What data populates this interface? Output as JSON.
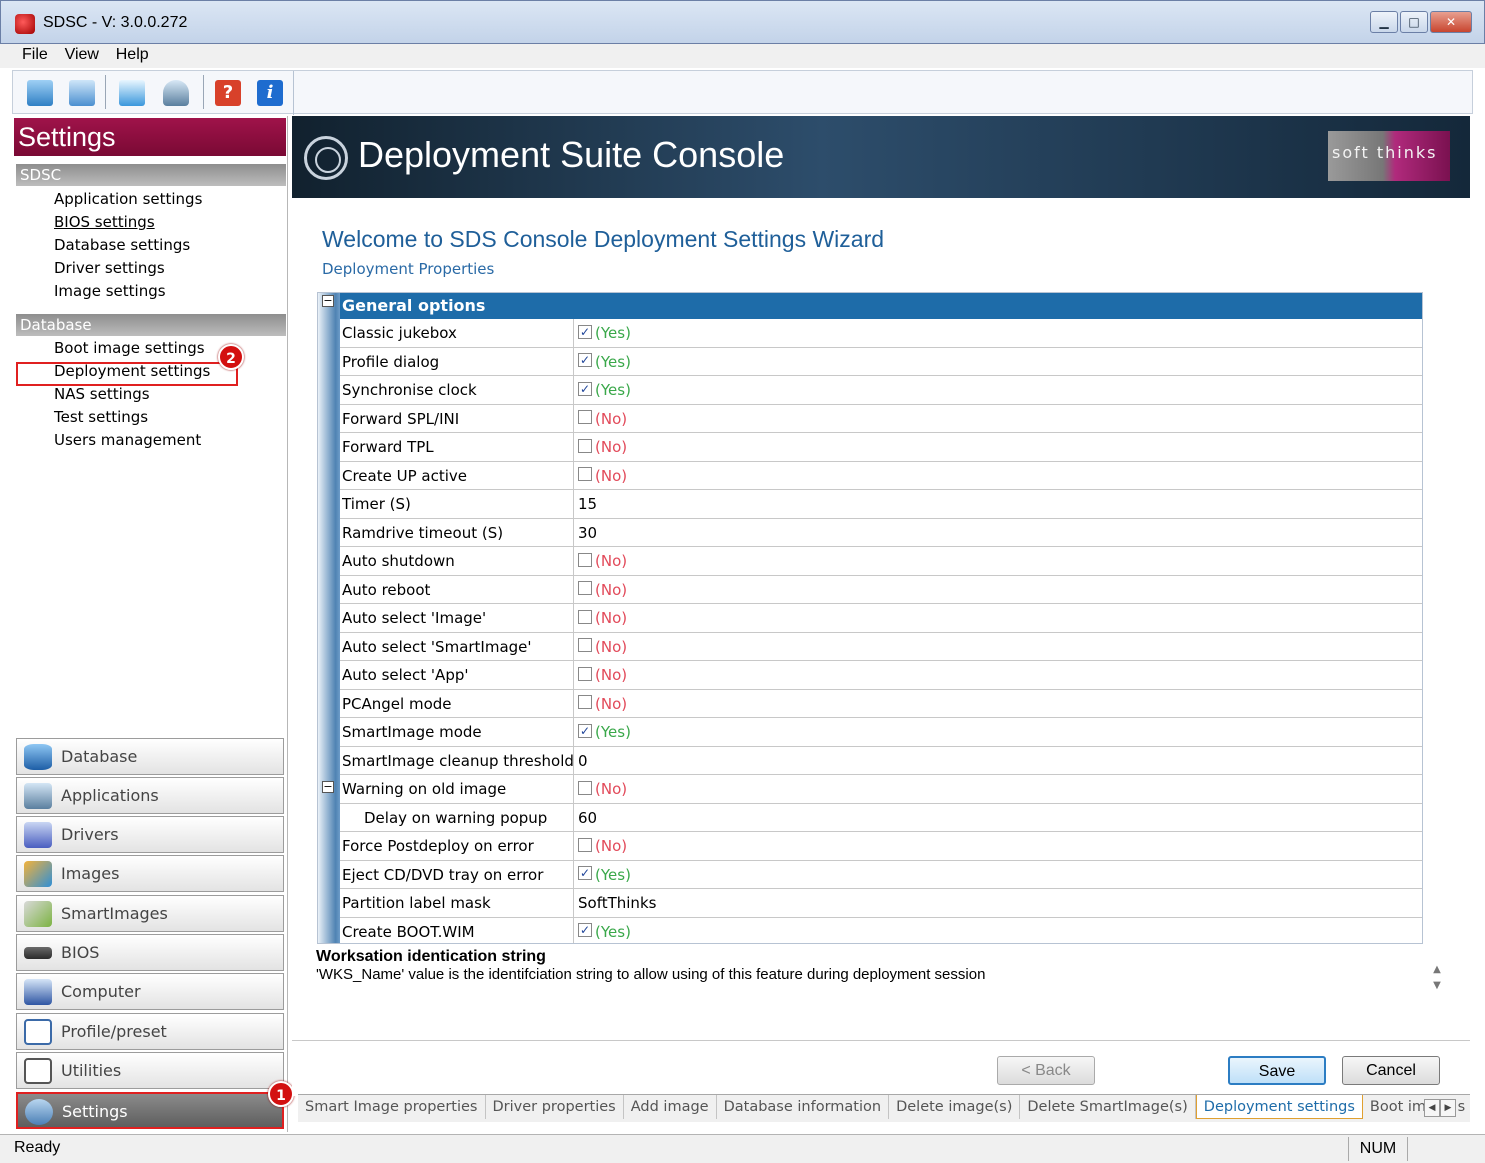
{
  "window": {
    "title": "SDSC - V: 3.0.0.272"
  },
  "menu": [
    "File",
    "View",
    "Help"
  ],
  "toolbar": {
    "icons": [
      "connect-icon",
      "network-icon",
      "monitor-icon",
      "deploy-icon",
      "help-icon",
      "info-icon"
    ],
    "help_glyph": "?",
    "info_glyph": "i"
  },
  "sidebar": {
    "header": "Settings",
    "groups": [
      {
        "label": "SDSC",
        "items": [
          "Application settings",
          "BIOS settings",
          "Database settings",
          "Driver settings",
          "Image settings"
        ]
      },
      {
        "label": "Database",
        "items": [
          "Boot image settings",
          "Deployment settings",
          "NAS settings",
          "Test settings",
          "Users management"
        ]
      }
    ],
    "buttons": [
      "Database",
      "Applications",
      "Drivers",
      "Images",
      "SmartImages",
      "BIOS",
      "Computer",
      "Profile/preset",
      "Utilities",
      "Settings"
    ],
    "active_button": "Settings",
    "callouts": {
      "settings": "1",
      "deployment": "2"
    }
  },
  "banner": {
    "title": "Deployment Suite Console",
    "brand": "soft thinks"
  },
  "wizard": {
    "title": "Welcome to SDS Console Deployment Settings Wizard",
    "subtitle": "Deployment Properties"
  },
  "grid": {
    "category": "General options",
    "rows": [
      {
        "name": "Classic jukebox",
        "type": "bool",
        "checked": true,
        "label": "(Yes)"
      },
      {
        "name": "Profile dialog",
        "type": "bool",
        "checked": true,
        "label": "(Yes)"
      },
      {
        "name": "Synchronise clock",
        "type": "bool",
        "checked": true,
        "label": "(Yes)"
      },
      {
        "name": "Forward SPL/INI",
        "type": "bool",
        "checked": false,
        "label": "(No)"
      },
      {
        "name": "Forward TPL",
        "type": "bool",
        "checked": false,
        "label": "(No)"
      },
      {
        "name": "Create UP active",
        "type": "bool",
        "checked": false,
        "label": "(No)"
      },
      {
        "name": "Timer (S)",
        "type": "text",
        "value": "15"
      },
      {
        "name": "Ramdrive timeout (S)",
        "type": "text",
        "value": "30"
      },
      {
        "name": "Auto shutdown",
        "type": "bool",
        "checked": false,
        "label": "(No)"
      },
      {
        "name": "Auto reboot",
        "type": "bool",
        "checked": false,
        "label": "(No)"
      },
      {
        "name": "Auto select 'Image'",
        "type": "bool",
        "checked": false,
        "label": "(No)"
      },
      {
        "name": "Auto select 'SmartImage'",
        "type": "bool",
        "checked": false,
        "label": "(No)"
      },
      {
        "name": "Auto select 'App'",
        "type": "bool",
        "checked": false,
        "label": "(No)"
      },
      {
        "name": "PCAngel mode",
        "type": "bool",
        "checked": false,
        "label": "(No)"
      },
      {
        "name": "SmartImage mode",
        "type": "bool",
        "checked": true,
        "label": "(Yes)"
      },
      {
        "name": "SmartImage cleanup threshold",
        "type": "text",
        "value": "0"
      },
      {
        "name": "Warning on old image",
        "type": "bool",
        "checked": false,
        "label": "(No)",
        "collapsible": true
      },
      {
        "name": "Delay on warning popup",
        "type": "text",
        "value": "60",
        "indent": true
      },
      {
        "name": "Force Postdeploy on error",
        "type": "bool",
        "checked": false,
        "label": "(No)"
      },
      {
        "name": "Eject CD/DVD tray on error",
        "type": "bool",
        "checked": true,
        "label": "(Yes)"
      },
      {
        "name": "Partition label mask",
        "type": "text",
        "value": "SoftThinks"
      },
      {
        "name": "Create BOOT.WIM",
        "type": "bool",
        "checked": true,
        "label": "(Yes)"
      }
    ]
  },
  "description": {
    "title": "Worksation identication string",
    "text": "'WKS_Name' value is the identifciation string to allow using of this feature during deployment session"
  },
  "buttons": {
    "back": "< Back",
    "save": "Save",
    "cancel": "Cancel"
  },
  "tabs": [
    "Smart Image properties",
    "Driver properties",
    "Add image",
    "Database information",
    "Delete image(s)",
    "Delete SmartImage(s)",
    "Deployment settings",
    "Boot image s"
  ],
  "active_tab": "Deployment settings",
  "status": {
    "text": "Ready",
    "num": "NUM"
  },
  "colors": {
    "accent": "#1e6ca9",
    "settings_header": "#8e0d40",
    "yes": "#3aa84a",
    "no": "#e24a5a",
    "callout": "#d31010"
  }
}
